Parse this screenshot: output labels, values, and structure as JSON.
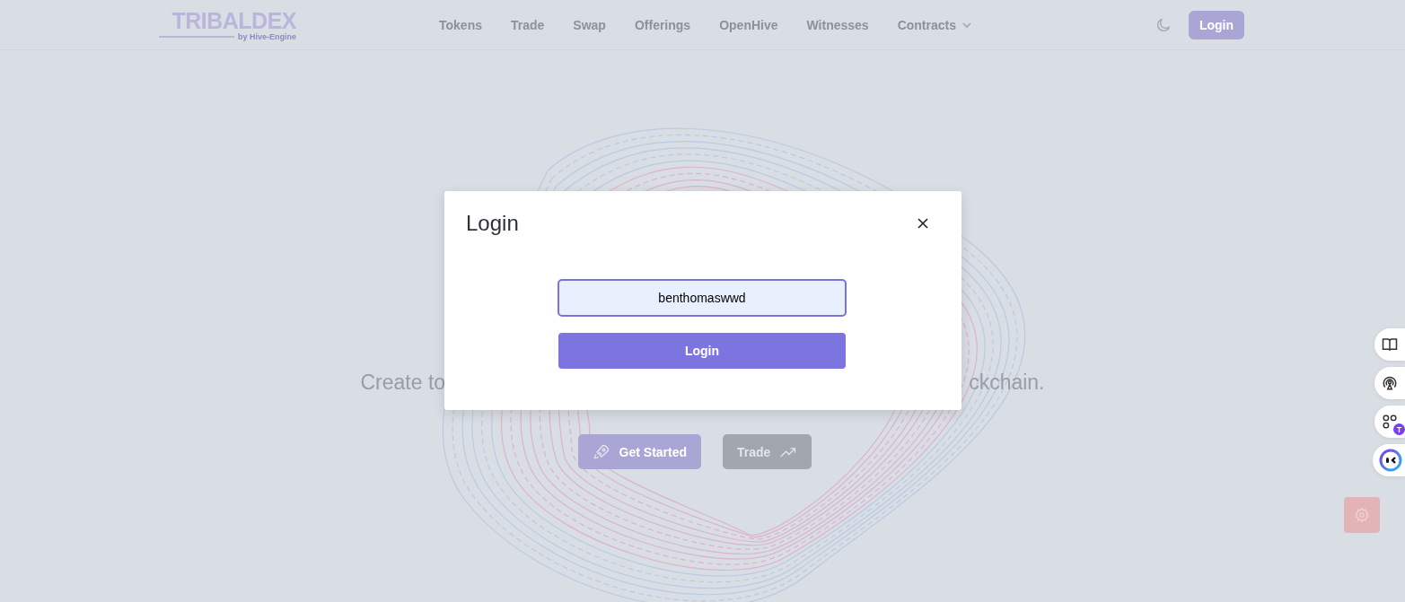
{
  "header": {
    "logo": {
      "title": "TRIBALDEX",
      "subtitle": "by Hive-Engine"
    },
    "nav": [
      {
        "label": "Tokens",
        "has_menu": false
      },
      {
        "label": "Trade",
        "has_menu": false
      },
      {
        "label": "Swap",
        "has_menu": false
      },
      {
        "label": "Offerings",
        "has_menu": false
      },
      {
        "label": "OpenHive",
        "has_menu": false
      },
      {
        "label": "Witnesses",
        "has_menu": false
      },
      {
        "label": "Contracts",
        "has_menu": true
      }
    ],
    "login_button": "Login"
  },
  "hero": {
    "tagline_start": "Create to",
    "tagline_end": "ckchain.",
    "buttons": [
      {
        "kind": "primary",
        "label": "Get Started"
      },
      {
        "kind": "secondary",
        "label": "Trade"
      }
    ]
  },
  "side_buttons": [
    {
      "kind": "book"
    },
    {
      "kind": "broadcast"
    },
    {
      "kind": "apps",
      "badge": "T"
    },
    {
      "kind": "bot"
    }
  ],
  "modal": {
    "title": "Login",
    "username": "benthomaswwd",
    "submit": "Login"
  }
}
